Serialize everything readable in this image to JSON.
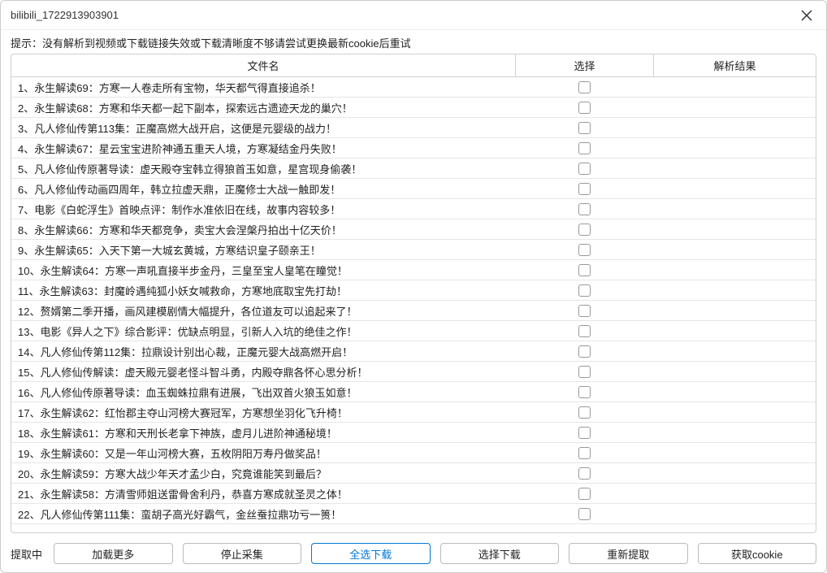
{
  "window": {
    "title": "bilibili_1722913903901"
  },
  "hint": "提示：没有解析到视频或下载链接失效或下载清晰度不够请尝试更换最新cookie后重试",
  "table": {
    "headers": {
      "name": "文件名",
      "select": "选择",
      "result": "解析结果"
    },
    "rows": [
      {
        "name": "1、永生解读69：方寒一人卷走所有宝物，华天都气得直接追杀！",
        "selected": false,
        "result": ""
      },
      {
        "name": "2、永生解读68：方寒和华天都一起下副本，探索远古遗迹天龙的巢穴！",
        "selected": false,
        "result": ""
      },
      {
        "name": "3、凡人修仙传第113集：正魔高燃大战开启，这便是元婴级的战力！",
        "selected": false,
        "result": ""
      },
      {
        "name": "4、永生解读67：星云宝宝进阶神通五重天人境，方寒凝结金丹失败！",
        "selected": false,
        "result": ""
      },
      {
        "name": "5、凡人修仙传原著导读：虚天殿夺宝韩立得狼首玉如意，星宫现身偷袭！",
        "selected": false,
        "result": ""
      },
      {
        "name": "6、凡人修仙传动画四周年，韩立拉虚天鼎，正魔修士大战一触即发！",
        "selected": false,
        "result": ""
      },
      {
        "name": "7、电影《白蛇浮生》首映点评：制作水准依旧在线，故事内容较多！",
        "selected": false,
        "result": ""
      },
      {
        "name": "8、永生解读66：方寒和华天都竞争，卖宝大会涅槃丹拍出十亿天价！",
        "selected": false,
        "result": ""
      },
      {
        "name": "9、永生解读65：入天下第一大城玄黄城，方寒结识皇子颐亲王！",
        "selected": false,
        "result": ""
      },
      {
        "name": "10、永生解读64：方寒一声吼直接半步金丹，三皇至宝人皇笔在瞳觉！",
        "selected": false,
        "result": ""
      },
      {
        "name": "11、永生解读63：封魔岭遇纯狐小妖女喊救命，方寒地底取宝先打劫！",
        "selected": false,
        "result": ""
      },
      {
        "name": "12、赘婿第二季开播，画风建模剧情大幅提升，各位道友可以追起来了！",
        "selected": false,
        "result": ""
      },
      {
        "name": "13、电影《异人之下》综合影评：优缺点明显，引新人入坑的绝佳之作！",
        "selected": false,
        "result": ""
      },
      {
        "name": "14、凡人修仙传第112集：拉鼎设计别出心裁，正魔元婴大战高燃开启！",
        "selected": false,
        "result": ""
      },
      {
        "name": "15、凡人修仙传解读：虚天殿元婴老怪斗智斗勇，内殿夺鼎各怀心思分析！",
        "selected": false,
        "result": ""
      },
      {
        "name": "16、凡人修仙传原著导读：血玉蜘蛛拉鼎有进展，飞出双首火狼玉如意！",
        "selected": false,
        "result": ""
      },
      {
        "name": "17、永生解读62：红怡郡主夺山河榜大赛冠军，方寒想坐羽化飞升椅！",
        "selected": false,
        "result": ""
      },
      {
        "name": "18、永生解读61：方寒和天刑长老拿下神族，虚月儿进阶神通秘境！",
        "selected": false,
        "result": ""
      },
      {
        "name": "19、永生解读60：又是一年山河榜大赛，五枚阴阳万寿丹做奖品！",
        "selected": false,
        "result": ""
      },
      {
        "name": "20、永生解读59：方寒大战少年天才孟少白，究竟谁能笑到最后？",
        "selected": false,
        "result": ""
      },
      {
        "name": "21、永生解读58：方清雪师姐送雷骨舍利丹，恭喜方寒成就圣灵之体！",
        "selected": false,
        "result": ""
      },
      {
        "name": "22、凡人修仙传第111集：蛮胡子高光好霸气，金丝蚕拉鼎功亏一篑！",
        "selected": false,
        "result": ""
      }
    ]
  },
  "footer": {
    "status": "提取中",
    "buttons": {
      "load_more": "加载更多",
      "stop_collect": "停止采集",
      "select_all_download": "全选下载",
      "select_download": "选择下载",
      "re_extract": "重新提取",
      "get_cookie": "获取cookie"
    }
  }
}
